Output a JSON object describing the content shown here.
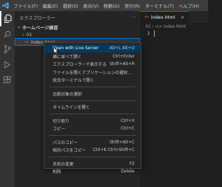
{
  "titlebar": {
    "menu": [
      "ファイル(F)",
      "編集(E)",
      "選択(S)",
      "表示(V)",
      "移動(G)",
      "実行(R)",
      "ターミナル(T)",
      "ヘルプ(H)"
    ]
  },
  "sidebar": {
    "title": "エクスプローラー",
    "more": "···",
    "folder": "ホームページ練習",
    "subfolder": "01",
    "file": "index.html",
    "file_icon": "<>"
  },
  "editor": {
    "tab_label": "index.html",
    "tab_close": "×",
    "breadcrumb": "01 › <> index.html",
    "line_number": "1"
  },
  "context_menu": {
    "group1": [
      {
        "label": "Open with Live Server",
        "shortcut": "Alt+L Alt+O"
      },
      {
        "label": "横に並べて開く",
        "shortcut": "Ctrl+Enter"
      },
      {
        "label": "エクスプローラーで表示する",
        "shortcut": "Shift+Alt+R"
      },
      {
        "label": "ファイルを開くアプリケーションの選択...",
        "shortcut": ""
      },
      {
        "label": "統合ターミナルで開く",
        "shortcut": ""
      }
    ],
    "group2": [
      {
        "label": "比較対象の選択",
        "shortcut": ""
      }
    ],
    "group3": [
      {
        "label": "タイムラインを開く",
        "shortcut": ""
      }
    ],
    "group4": [
      {
        "label": "切り取り",
        "shortcut": "Ctrl+X"
      },
      {
        "label": "コピー",
        "shortcut": "Ctrl+C"
      }
    ],
    "group5": [
      {
        "label": "パスのコピー",
        "shortcut": "Shift+Alt+C"
      },
      {
        "label": "相対パスをコピー",
        "shortcut": "Ctrl+K Ctrl+Shift+C"
      }
    ],
    "group6": [
      {
        "label": "名前の変更",
        "shortcut": "F2"
      },
      {
        "label": "削除",
        "shortcut": "Delete"
      }
    ]
  },
  "colors": {
    "accent": "#007acc",
    "highlight": "#04395e",
    "html_icon": "#e37933"
  }
}
